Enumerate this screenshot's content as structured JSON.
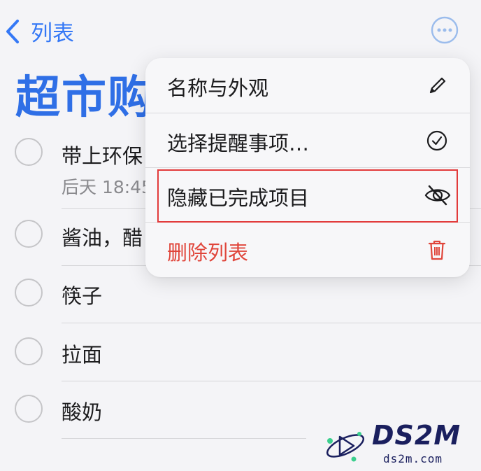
{
  "nav": {
    "back_label": "列表"
  },
  "list": {
    "title": "超市购",
    "items": [
      {
        "text": "带上环保",
        "sub": "后天 18:45"
      },
      {
        "text": "酱油，醋"
      },
      {
        "text": "筷子"
      },
      {
        "text": "拉面"
      },
      {
        "text": "酸奶"
      }
    ]
  },
  "menu": {
    "items": [
      {
        "label": "名称与外观",
        "icon": "pencil-icon"
      },
      {
        "label": "选择提醒事项…",
        "icon": "checkmark-circle-icon"
      },
      {
        "label": "隐藏已完成项目",
        "icon": "eye-slash-icon"
      },
      {
        "label": "删除列表",
        "icon": "trash-icon"
      }
    ]
  },
  "watermark": {
    "text": "DS2M",
    "sub": "ds2m.com"
  },
  "colors": {
    "accent": "#3478f6",
    "title": "#2f6fe6",
    "danger": "#e0453a",
    "highlight": "#e23b3b"
  }
}
